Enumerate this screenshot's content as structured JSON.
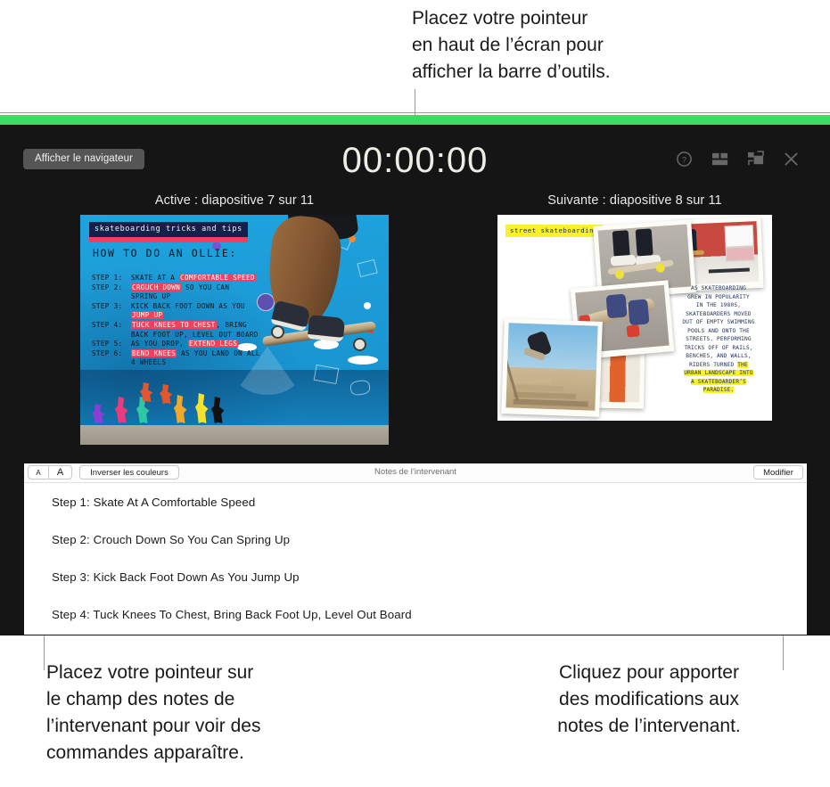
{
  "callouts": {
    "top": "Placez votre pointeur\nen haut de l’écran pour\nafficher la barre d’outils.",
    "bottom_left": "Placez votre pointeur sur\nle champ des notes de\nl’intervenant pour voir des\ncommandes apparaître.",
    "bottom_right": "Cliquez pour apporter\ndes modifications aux\nnotes de l’intervenant."
  },
  "presenter": {
    "accent_green": "#3ddb63",
    "background": "#151515",
    "navigator_button": "Afficher le navigateur",
    "timer": "00:00:00",
    "toolbar_icons": [
      {
        "name": "help-icon",
        "glyph": "?"
      },
      {
        "name": "layout-icon",
        "glyph": "▤"
      },
      {
        "name": "display-swap-icon",
        "glyph": "⧉"
      },
      {
        "name": "close-icon",
        "glyph": "✕"
      }
    ],
    "current_slide": {
      "caption": "Active : diapositive 7 sur 11",
      "title": "skateboarding tricks and tips",
      "heading": "HOW TO DO AN OLLIE:",
      "steps": [
        {
          "label": "STEP 1:",
          "parts": [
            {
              "t": "SKATE AT A ",
              "hl": false
            },
            {
              "t": "COMFORTABLE SPEED",
              "hl": true
            }
          ]
        },
        {
          "label": "STEP 2:",
          "parts": [
            {
              "t": "CROUCH DOWN",
              "hl": true
            },
            {
              "t": " SO YOU CAN",
              "hl": false
            }
          ]
        },
        {
          "label": "",
          "parts": [
            {
              "t": "SPRING UP",
              "hl": false
            }
          ]
        },
        {
          "label": "STEP 3:",
          "parts": [
            {
              "t": "KICK BACK FOOT DOWN AS YOU",
              "hl": false
            }
          ]
        },
        {
          "label": "",
          "parts": [
            {
              "t": "JUMP UP",
              "hl": true
            }
          ]
        },
        {
          "label": "STEP 4:",
          "parts": [
            {
              "t": "TUCK KNEES TO CHEST",
              "hl": true
            },
            {
              "t": ", BRING",
              "hl": false
            }
          ]
        },
        {
          "label": "",
          "parts": [
            {
              "t": "BACK FOOT UP, LEVEL OUT BOARD",
              "hl": false
            }
          ]
        },
        {
          "label": "STEP 5:",
          "parts": [
            {
              "t": "AS YOU DROP, ",
              "hl": false
            },
            {
              "t": "EXTEND LEGS",
              "hl": true
            }
          ]
        },
        {
          "label": "STEP 6:",
          "parts": [
            {
              "t": "BEND KNEES",
              "hl": true
            },
            {
              "t": " AS YOU LAND ON ALL",
              "hl": false
            }
          ]
        },
        {
          "label": "",
          "parts": [
            {
              "t": "4 WHEELS",
              "hl": false
            }
          ]
        }
      ],
      "highlight_color": "#f2415e"
    },
    "next_slide": {
      "caption": "Suivante : diapositive 8 sur 11",
      "title": "street skateboarding",
      "highlight_color": "#f9f22a",
      "body": [
        {
          "t": "AS SKATEBOARDING",
          "hl": false
        },
        {
          "t": "GREW IN POPULARITY",
          "hl": false
        },
        {
          "t": "IN THE 1980S,",
          "hl": false
        },
        {
          "t": "SKATEBOARDERS MOVED",
          "hl": false
        },
        {
          "t": "OUT OF EMPTY SWIMMING",
          "hl": false
        },
        {
          "t": "POOLS AND ONTO THE",
          "hl": false
        },
        {
          "t": "STREETS. PERFORMING",
          "hl": false
        },
        {
          "t": "TRICKS OFF OF RAILS,",
          "hl": false
        },
        {
          "t": "BENCHES, AND WALLS,",
          "hl": false
        },
        {
          "t": "RIDERS TURNED ",
          "hl": false,
          "tail": "THE",
          "tail_hl": true
        },
        {
          "t": "URBAN LANDSCAPE INTO",
          "hl": true
        },
        {
          "t": "A SKATEBOARDER’S",
          "hl": true
        },
        {
          "t": "PARADISE.",
          "hl": true
        }
      ]
    }
  },
  "notes": {
    "toolbar": {
      "font_decrease": "A",
      "font_increase": "A",
      "invert_colors": "Inverser les couleurs",
      "title": "Notes de l’intervenant",
      "edit": "Modifier"
    },
    "lines": [
      "Step 1: Skate At A Comfortable Speed",
      "Step 2: Crouch Down So You Can Spring Up",
      "Step 3: Kick Back Foot Down As You Jump Up",
      "Step 4: Tuck Knees To Chest, Bring Back Foot Up, Level Out Board"
    ]
  }
}
